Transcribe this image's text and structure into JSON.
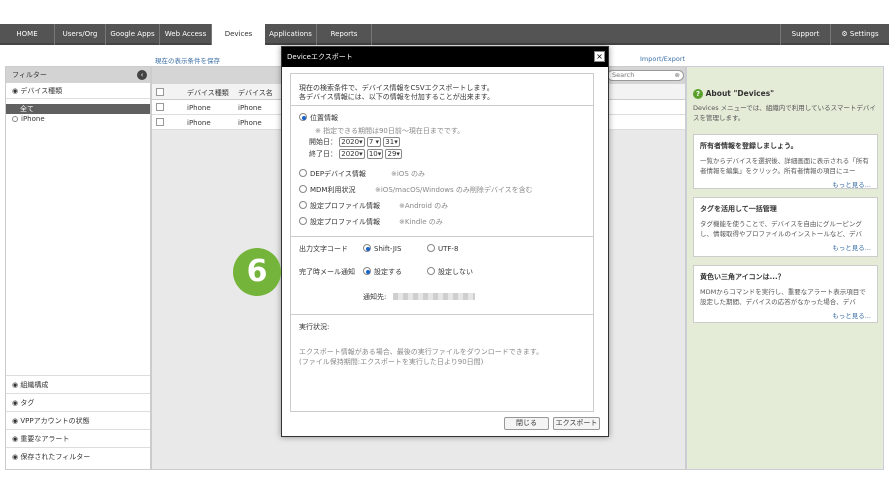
{
  "nav": {
    "tabs": [
      "HOME",
      "Users/Org",
      "Google Apps",
      "Web Access",
      "Devices",
      "Applications",
      "Reports"
    ],
    "support": "Support",
    "settings": "Settings"
  },
  "toolbar": {
    "save_filter": "現在の表示条件を保存",
    "import_export": "Import/Export",
    "search_placeholder": "Search"
  },
  "sidebar": {
    "filter_title": "フィルター",
    "device_type": "デバイス種類",
    "all": "全て",
    "iphone": "iPhone",
    "bottom": [
      "組織構成",
      "タグ",
      "VPPアカウントの状態",
      "重要なアラート",
      "保存されたフィルター"
    ]
  },
  "table": {
    "headers": [
      "デバイス種類",
      "デバイス名"
    ],
    "rows": [
      [
        "iPhone",
        "iPhone"
      ],
      [
        "iPhone",
        "iPhone"
      ]
    ]
  },
  "right": {
    "title": "About \"Devices\"",
    "intro": "Devices メニューでは、組織内で利用しているスマートデバイスを管理します。",
    "cards": [
      {
        "title": "所有者情報を登録しましょう。",
        "body": "一覧からデバイスを選択後、詳細画面に表示される「所有者情報を編集」をクリック。所有者情報の項目にユー",
        "more": "もっと見る..."
      },
      {
        "title": "タグを活用して一括管理",
        "body": "タグ機能を使うことで、デバイスを自由にグルーピングし、情報取得やプロファイルのインストールなど、デバ",
        "more": "もっと見る..."
      },
      {
        "title": "黄色い三角アイコンは...？",
        "body": "MDMからコマンドを実行し、重要なアラート表示項目で設定した期間、デバイスの応答がなかった場合、デバ",
        "more": "もっと見る..."
      }
    ]
  },
  "dialog": {
    "title": "Deviceエクスポート",
    "intro1": "現在の検索条件で、デバイス情報をCSVエクスポートします。",
    "intro2": "各デバイス情報には、以下の情報を付加することが出来ます。",
    "location": "位置情報",
    "location_note": "※ 指定できる期間は90日前〜現在日までです。",
    "start_label": "開始日：",
    "end_label": "終了日：",
    "start": {
      "y": "2020",
      "m": "7",
      "d": "31"
    },
    "end": {
      "y": "2020",
      "m": "10",
      "d": "29"
    },
    "options": [
      {
        "label": "DEPデバイス情報",
        "note": "※iOS のみ"
      },
      {
        "label": "MDM利用状況",
        "note": "※iOS/macOS/Windows のみ削除デバイスを含む"
      },
      {
        "label": "設定プロファイル情報",
        "note": "※Android のみ"
      },
      {
        "label": "設定プロファイル情報",
        "note": "※Kindle のみ"
      }
    ],
    "charset_label": "出力文字コード",
    "charset_a": "Shift-JIS",
    "charset_b": "UTF-8",
    "notify_label": "完了時メール通知",
    "notify_yes": "設定する",
    "notify_no": "設定しない",
    "notify_to": "通知先:",
    "status_label": "実行状況:",
    "status_text1": "エクスポート情報がある場合、最後の実行ファイルをダウンロードできます。",
    "status_text2": "(ファイル保持期間:エクスポートを実行した日より90日間)",
    "close": "閉じる",
    "export": "エクスポート"
  },
  "step_badge": "6"
}
